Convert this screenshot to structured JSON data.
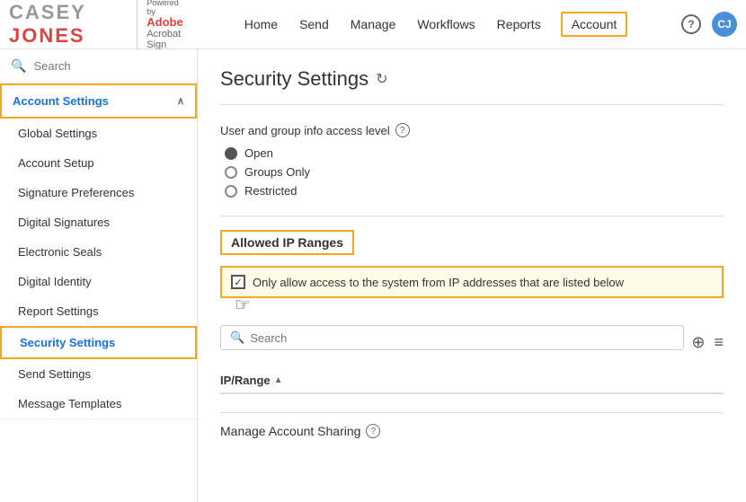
{
  "logo": {
    "casey": "CASEY",
    "jones": "JONES",
    "powered_by": "Powered by",
    "brand_name": "Adobe",
    "brand_product": "Acrobat Sign"
  },
  "nav": {
    "links": [
      "Home",
      "Send",
      "Manage",
      "Workflows",
      "Reports",
      "Account"
    ],
    "active": "Account"
  },
  "sidebar": {
    "search_placeholder": "Search",
    "section": {
      "label": "Account Settings",
      "chevron": "∧"
    },
    "items": [
      {
        "id": "global-settings",
        "label": "Global Settings",
        "active": false
      },
      {
        "id": "account-setup",
        "label": "Account Setup",
        "active": false
      },
      {
        "id": "signature-preferences",
        "label": "Signature Preferences",
        "active": false
      },
      {
        "id": "digital-signatures",
        "label": "Digital Signatures",
        "active": false
      },
      {
        "id": "electronic-seals",
        "label": "Electronic Seals",
        "active": false
      },
      {
        "id": "digital-identity",
        "label": "Digital Identity",
        "active": false
      },
      {
        "id": "report-settings",
        "label": "Report Settings",
        "active": false
      },
      {
        "id": "security-settings",
        "label": "Security Settings",
        "active": true
      },
      {
        "id": "send-settings",
        "label": "Send Settings",
        "active": false
      },
      {
        "id": "message-templates",
        "label": "Message Templates",
        "active": false
      }
    ]
  },
  "content": {
    "page_title": "Security Settings",
    "refresh_icon": "↻",
    "user_group_section": {
      "label": "User and group info access level",
      "info_icon": "?",
      "options": [
        {
          "id": "open",
          "label": "Open",
          "selected": true
        },
        {
          "id": "groups-only",
          "label": "Groups Only",
          "selected": false
        },
        {
          "id": "restricted",
          "label": "Restricted",
          "selected": false
        }
      ]
    },
    "ip_ranges": {
      "header": "Allowed IP Ranges",
      "checkbox_label": "Only allow access to the system from IP addresses that are listed below",
      "checkbox_checked": true,
      "search_placeholder": "Search",
      "table": {
        "column": "IP/Range",
        "sort_arrow": "▲"
      },
      "add_icon": "⊕",
      "menu_icon": "≡"
    },
    "manage_sharing": {
      "label": "Manage Account Sharing",
      "info_icon": "?"
    }
  }
}
